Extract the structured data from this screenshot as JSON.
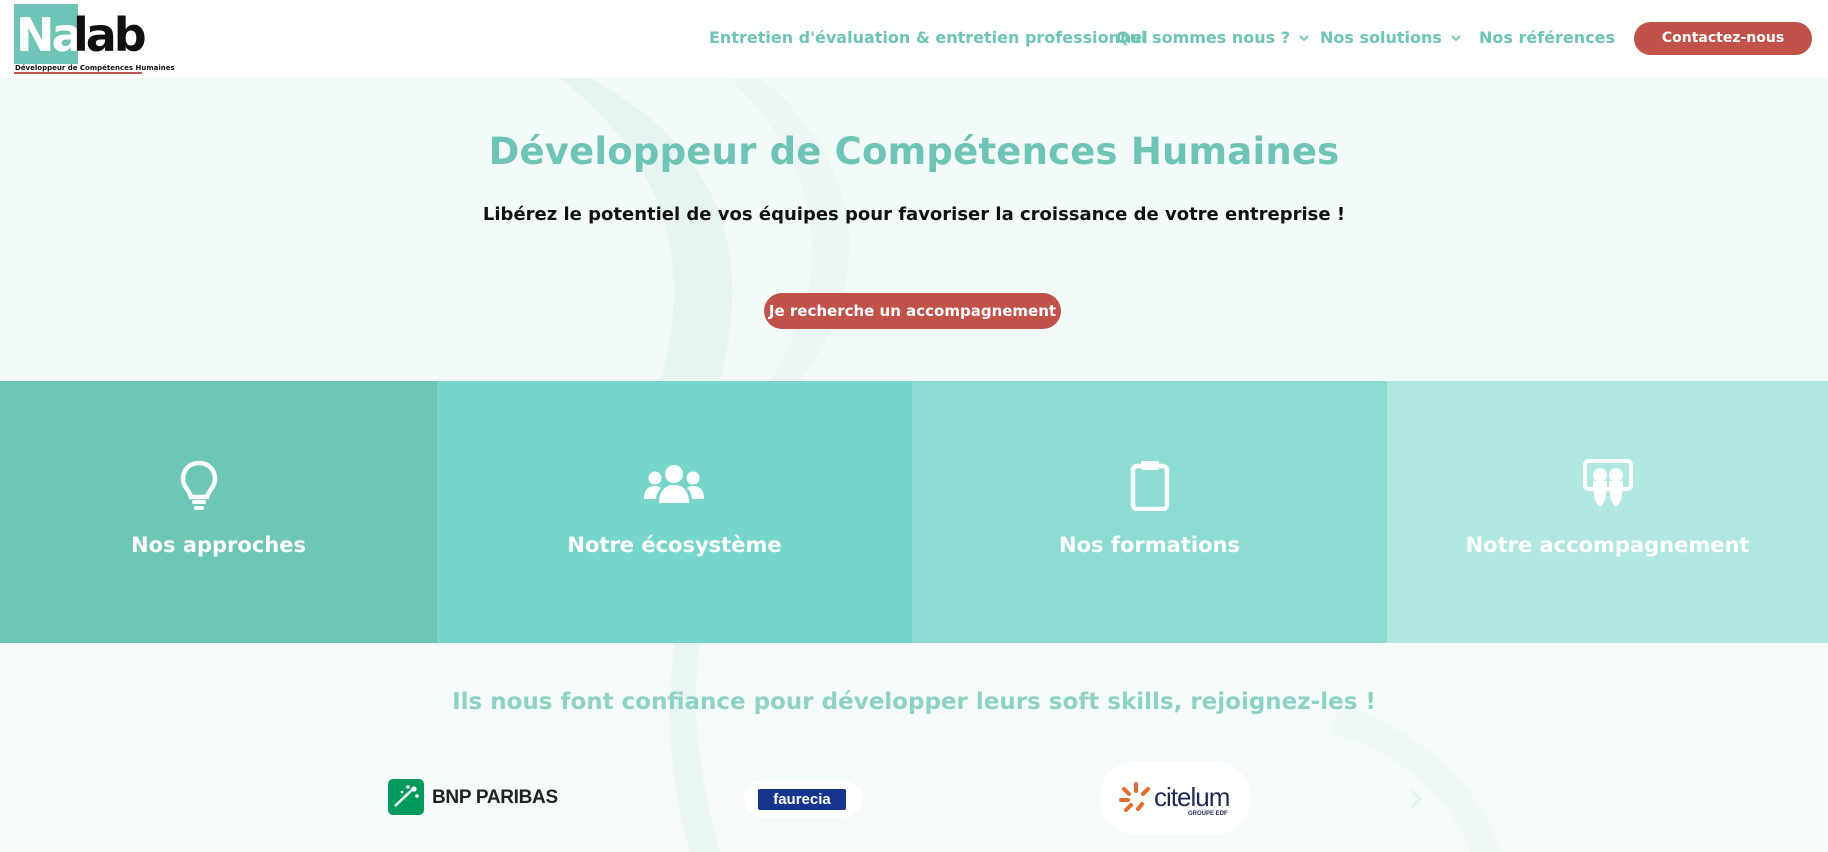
{
  "logo": {
    "part1": "Na",
    "part2": "lab",
    "tagline": "Développeur de Compétences Humaines"
  },
  "nav": {
    "items": [
      {
        "label": "Entretien d'évaluation & entretien professionnel",
        "has_dropdown": false
      },
      {
        "label": "Qui sommes nous ?",
        "has_dropdown": true
      },
      {
        "label": "Nos solutions",
        "has_dropdown": true
      },
      {
        "label": "Nos références",
        "has_dropdown": false
      }
    ],
    "cta_label": "Contactez-nous"
  },
  "hero": {
    "title": "Développeur de Compétences Humaines",
    "subtitle": "Libérez le potentiel de vos équipes pour favoriser la croissance de votre entreprise !",
    "cta_label": "Je recherche un accompagnement"
  },
  "tiles": [
    {
      "label": "Nos approches",
      "icon": "lightbulb-icon",
      "color": "#6ec6b7"
    },
    {
      "label": "Notre écosystème",
      "icon": "users-icon",
      "color": "#77d6cc"
    },
    {
      "label": "Nos formations",
      "icon": "clipboard-icon",
      "color": "#8cdcd3"
    },
    {
      "label": "Notre accompagnement",
      "icon": "slideshare-icon",
      "color": "#b0e7e1"
    }
  ],
  "trust": {
    "title": "Ils nous font confiance pour développer leurs soft skills, rejoignez-les !",
    "brands": [
      {
        "name": "BNP PARIBAS"
      },
      {
        "name": "faurecia"
      },
      {
        "name": "citelum",
        "subline": "GROUPE EDF"
      }
    ]
  },
  "colors": {
    "accent": "#6ec4b6",
    "cta": "#c0524a"
  }
}
